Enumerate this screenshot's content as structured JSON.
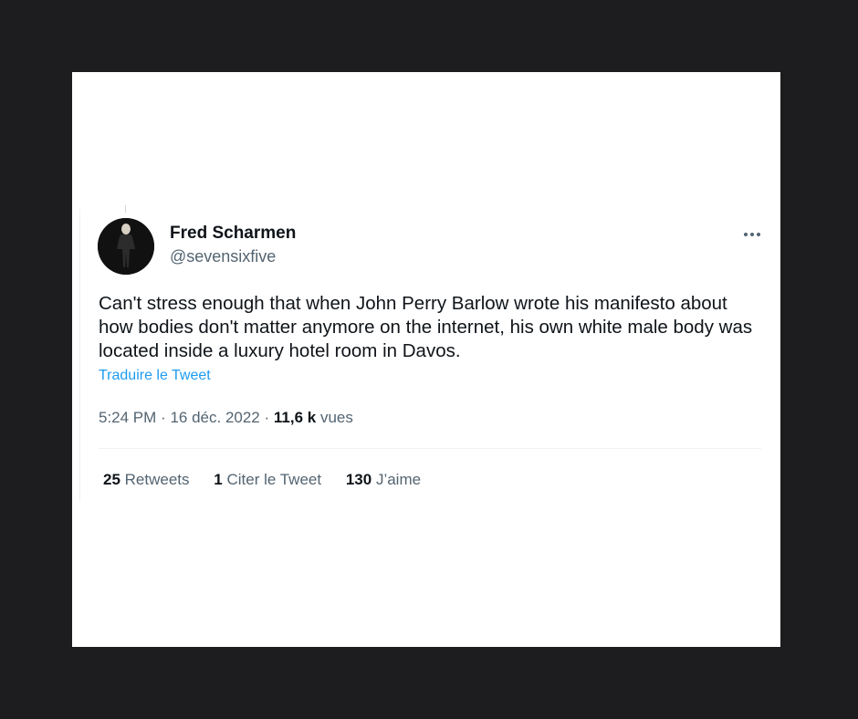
{
  "tweet": {
    "author_name": "Fred Scharmen",
    "author_handle": "@sevensixfive",
    "text": "Can't stress enough that when John Perry Barlow wrote his manifesto about how bodies don't matter anymore on the internet, his own white male body was located inside a luxury hotel room in Davos.",
    "translate_label": "Traduire le Tweet",
    "time": "5:24 PM",
    "date": "16 déc. 2022",
    "separator": "·",
    "views_count": "11,6 k",
    "views_label": "vues",
    "more_icon": "more-options-icon"
  },
  "stats": {
    "retweets_count": "25",
    "retweets_label": "Retweets",
    "quotes_count": "1",
    "quotes_label": "Citer le Tweet",
    "likes_count": "130",
    "likes_label": "J’aime"
  },
  "colors": {
    "background": "#1d1d1f",
    "card": "#ffffff",
    "text_primary": "#0f1419",
    "text_secondary": "#536471",
    "link": "#1d9bf0"
  }
}
